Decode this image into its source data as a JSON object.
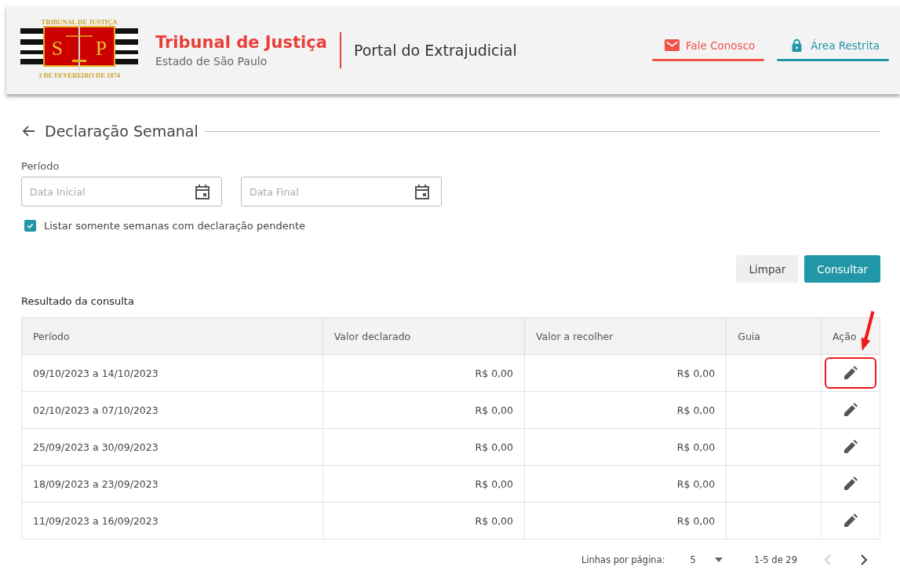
{
  "header": {
    "logo": {
      "top_text": "TRIBUNAL DE JUSTIÇA",
      "left_letter": "S",
      "right_letter": "P",
      "bottom_text": "3 DE FEVEREIRO DE 1874"
    },
    "title": "Tribunal de Justiça",
    "subtitle": "Estado de São Paulo",
    "portal": "Portal do Extrajudicial",
    "links": [
      {
        "label": "Fale Conosco",
        "kind": "mail",
        "color": "#f0524a"
      },
      {
        "label": "Área Restrita",
        "kind": "lock",
        "color": "#2196a6"
      }
    ]
  },
  "page": {
    "title": "Declaração Semanal"
  },
  "filters": {
    "label": "Período",
    "start": {
      "placeholder": "Data Inicial"
    },
    "end": {
      "placeholder": "Data Final"
    },
    "pending_only": {
      "label": "Listar somente semanas com declaração pendente",
      "checked": true
    }
  },
  "buttons": [
    {
      "label": "Limpar",
      "kind": "secondary"
    },
    {
      "label": "Consultar",
      "kind": "primary"
    }
  ],
  "results": {
    "title": "Resultado da consulta",
    "columns": [
      "Período",
      "Valor declarado",
      "Valor a recolher",
      "Guia",
      "Ação"
    ],
    "rows": [
      {
        "period": "09/10/2023 a 14/10/2023",
        "declared": "R$ 0,00",
        "due": "R$ 0,00",
        "highlighted": true
      },
      {
        "period": "02/10/2023 a 07/10/2023",
        "declared": "R$ 0,00",
        "due": "R$ 0,00",
        "highlighted": false
      },
      {
        "period": "25/09/2023 a 30/09/2023",
        "declared": "R$ 0,00",
        "due": "R$ 0,00",
        "highlighted": false
      },
      {
        "period": "18/09/2023 a 23/09/2023",
        "declared": "R$ 0,00",
        "due": "R$ 0,00",
        "highlighted": false
      },
      {
        "period": "11/09/2023 a 16/09/2023",
        "declared": "R$ 0,00",
        "due": "R$ 0,00",
        "highlighted": false
      }
    ]
  },
  "pagination": {
    "label": "Linhas por página:",
    "per_page": "5",
    "range": "1-5 de 29"
  }
}
